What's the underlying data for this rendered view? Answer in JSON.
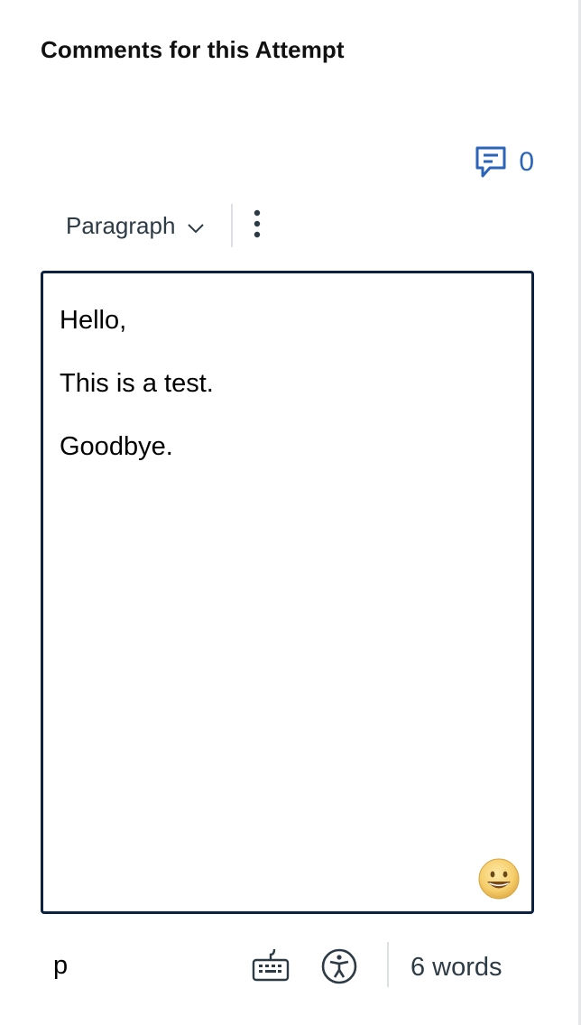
{
  "header": {
    "title": "Comments for this Attempt"
  },
  "comments": {
    "count": "0",
    "icon": "comment-icon",
    "accent_color": "#2b64b8"
  },
  "toolbar": {
    "block_format": "Paragraph",
    "block_icon": "chevron-down-icon",
    "more_icon": "vertical-ellipsis-icon"
  },
  "editor": {
    "paragraphs": [
      "Hello,",
      "This is a test.",
      "Goodbye."
    ],
    "border_color": "#0b2340",
    "emoji_icon": "grinning-face-icon"
  },
  "statusbar": {
    "path": "p",
    "keyboard_icon": "keyboard-icon",
    "accessibility_icon": "accessibility-icon",
    "word_count": "6 words"
  }
}
